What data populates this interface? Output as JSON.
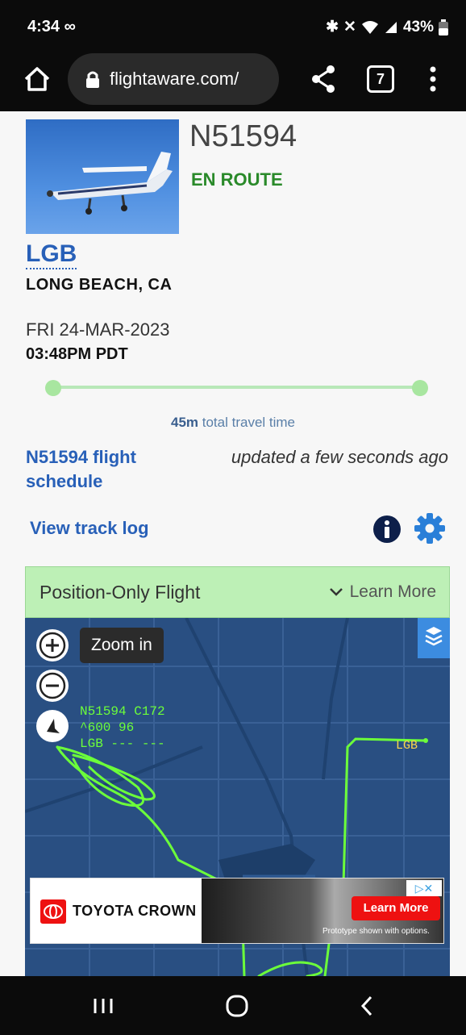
{
  "status_bar": {
    "time": "4:34",
    "battery": "43%"
  },
  "browser": {
    "url": "flightaware.com/",
    "tab_count": "7"
  },
  "flight": {
    "tail_number": "N51594",
    "status": "EN ROUTE",
    "status_color": "#2a8a2a",
    "origin_code": "LGB",
    "origin_city": "LONG BEACH, CA",
    "departure_date": "FRI 24-MAR-2023",
    "departure_time": "03:48PM PDT",
    "progress_fraction": 1.0
  },
  "travel": {
    "duration": "45m",
    "duration_suffix": "total travel time"
  },
  "links": {
    "schedule": "N51594 flight schedule",
    "updated": "updated a few seconds ago",
    "track_log": "View track log"
  },
  "position_bar": {
    "label": "Position-Only Flight",
    "learn_more": "Learn More",
    "color": "#bdf0b6"
  },
  "map": {
    "zoom_tooltip": "Zoom in",
    "flight_label_line1": "N51594 C172",
    "flight_label_line2": "^600 96",
    "flight_label_line3": "LGB --- ---",
    "destination_label": "LGB",
    "track_color": "#6cff3a"
  },
  "ad": {
    "brand": "TOYOTA CROWN",
    "cta": "Learn More",
    "disclaimer": "Prototype shown with options."
  },
  "colors": {
    "link": "#2860b8",
    "map_bg": "#294f82"
  }
}
